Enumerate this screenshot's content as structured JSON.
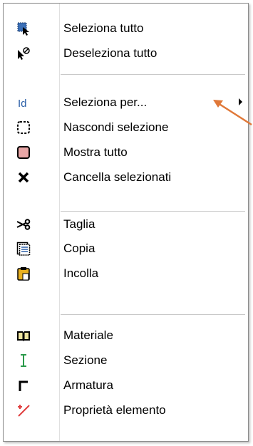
{
  "menu": {
    "items": [
      {
        "label": "Seleziona tutto",
        "icon": "select-all-icon"
      },
      {
        "label": "Deseleziona tutto",
        "icon": "deselect-all-icon"
      },
      {
        "label": "Seleziona per...",
        "icon": "select-by-id-icon",
        "submenu": true
      },
      {
        "label": "Nascondi selezione",
        "icon": "hide-selection-icon"
      },
      {
        "label": "Mostra tutto",
        "icon": "show-all-icon"
      },
      {
        "label": "Cancella selezionati",
        "icon": "delete-icon"
      },
      {
        "label": "Taglia",
        "icon": "cut-icon"
      },
      {
        "label": "Copia",
        "icon": "copy-icon"
      },
      {
        "label": "Incolla",
        "icon": "paste-icon"
      },
      {
        "label": "Materiale",
        "icon": "material-book-icon"
      },
      {
        "label": "Sezione",
        "icon": "section-icon"
      },
      {
        "label": "Armatura",
        "icon": "reinforcement-icon"
      },
      {
        "label": "Proprietà elemento",
        "icon": "element-properties-icon"
      }
    ]
  },
  "colors": {
    "callout_arrow": "#e07838",
    "show_all_fill": "#e8a6a6",
    "id_text": "#2a5fa8"
  }
}
